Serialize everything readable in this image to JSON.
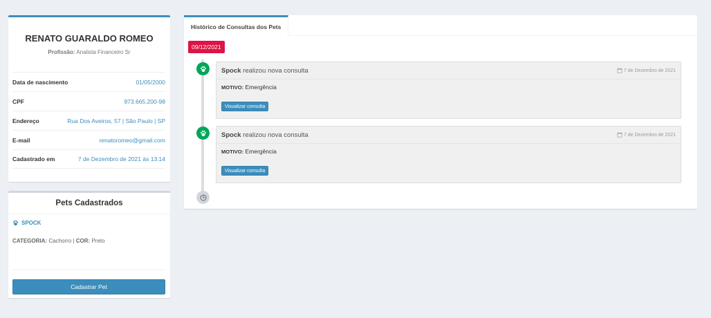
{
  "profile": {
    "name": "RENATO GUARALDO ROMEO",
    "job_label": "Profissão:",
    "job": "Analista Financeiro Sr",
    "fields": [
      {
        "label": "Data de nascimento",
        "value": "01/05/2000"
      },
      {
        "label": "CPF",
        "value": "973.665.200-98"
      },
      {
        "label": "Endereço",
        "value": "Rua Dos Aveiros, 57 | São Paulo | SP"
      },
      {
        "label": "E-mail",
        "value": "renatoromeo@gmail.com"
      },
      {
        "label": "Cadastrado em",
        "value": "7 de Dezembro de 2021 às 13:14"
      }
    ]
  },
  "pets": {
    "title": "Pets Cadastrados",
    "items": [
      {
        "name": "SPOCK",
        "category_label": "CATEGORIA:",
        "category": "Cachorro",
        "separator": "|",
        "color_label": "COR:",
        "color": "Preto"
      }
    ],
    "add_button": "Cadastrar Pet"
  },
  "history": {
    "tab": "Histórico de Consultas dos Pets",
    "date_label": "09/12/2021",
    "entries": [
      {
        "pet": "Spock",
        "action": "realizou nova consulta",
        "time": "7 de Dezembro de 2021",
        "reason_label": "MOTIVO:",
        "reason": "Emergência",
        "button": "Visualizar consulta"
      },
      {
        "pet": "Spock",
        "action": "realizou nova consulta",
        "time": "7 de Dezembro de 2021",
        "reason_label": "MOTIVO:",
        "reason": "Emergência",
        "button": "Visualizar consulta"
      }
    ]
  },
  "icons": {
    "paw": "paw-icon",
    "calendar": "calendar-icon",
    "clock": "clock-icon"
  },
  "colors": {
    "primary": "#3c8dbc",
    "success": "#00a65a",
    "danger": "#dd1444",
    "background": "#ecf0f5"
  }
}
